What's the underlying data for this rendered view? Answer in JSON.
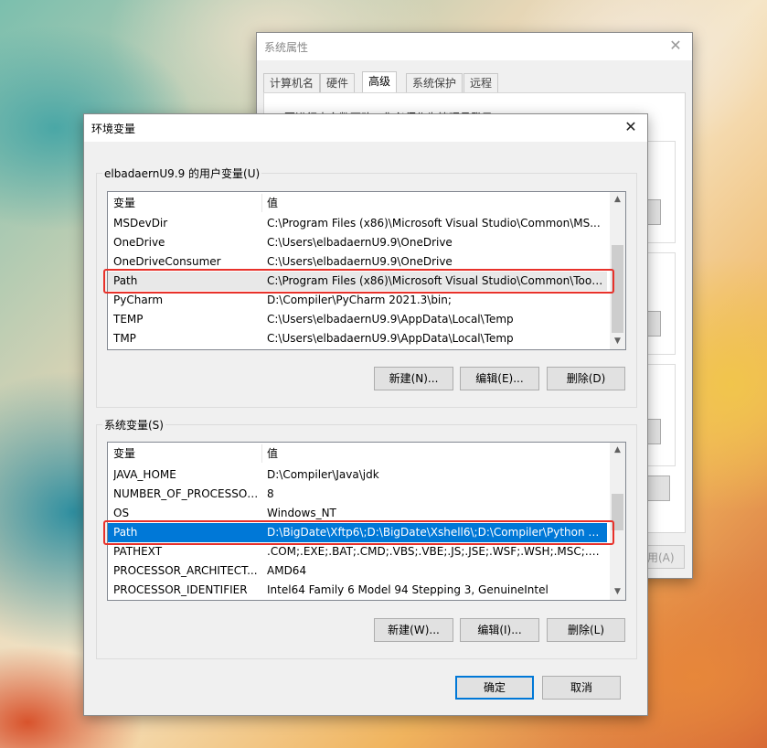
{
  "system_properties": {
    "title": "系统属性",
    "tabs": [
      {
        "label": "计算机名"
      },
      {
        "label": "硬件"
      },
      {
        "label": "高级"
      },
      {
        "label": "系统保护"
      },
      {
        "label": "远程"
      }
    ],
    "active_tab": "高级",
    "partial_text": "要进行大多数更改，你必须作为管理员登录。",
    "apply_label": "用(A)"
  },
  "env_dialog": {
    "title": "环境变量",
    "user_group_label": "elbadaernU9.9 的用户变量(U)",
    "system_group_label": "系统变量(S)",
    "columns": {
      "name": "变量",
      "value": "值"
    },
    "user_vars": [
      {
        "name": "MSDevDir",
        "value": "C:\\Program Files (x86)\\Microsoft Visual Studio\\Common\\MS..."
      },
      {
        "name": "OneDrive",
        "value": "C:\\Users\\elbadaernU9.9\\OneDrive"
      },
      {
        "name": "OneDriveConsumer",
        "value": "C:\\Users\\elbadaernU9.9\\OneDrive"
      },
      {
        "name": "Path",
        "value": "C:\\Program Files (x86)\\Microsoft Visual Studio\\Common\\Tool..."
      },
      {
        "name": "PyCharm",
        "value": "D:\\Compiler\\PyCharm 2021.3\\bin;"
      },
      {
        "name": "TEMP",
        "value": "C:\\Users\\elbadaernU9.9\\AppData\\Local\\Temp"
      },
      {
        "name": "TMP",
        "value": "C:\\Users\\elbadaernU9.9\\AppData\\Local\\Temp"
      }
    ],
    "system_vars": [
      {
        "name": "JAVA_HOME",
        "value": "D:\\Compiler\\Java\\jdk"
      },
      {
        "name": "NUMBER_OF_PROCESSORS",
        "value": "8"
      },
      {
        "name": "OS",
        "value": "Windows_NT"
      },
      {
        "name": "Path",
        "value": "D:\\BigDate\\Xftp6\\;D:\\BigDate\\Xshell6\\;D:\\Compiler\\Python 3\\..."
      },
      {
        "name": "PATHEXT",
        "value": ".COM;.EXE;.BAT;.CMD;.VBS;.VBE;.JS;.JSE;.WSF;.WSH;.MSC;.PY;.P..."
      },
      {
        "name": "PROCESSOR_ARCHITECT...",
        "value": "AMD64"
      },
      {
        "name": "PROCESSOR_IDENTIFIER",
        "value": "Intel64 Family 6 Model 94 Stepping 3, GenuineIntel"
      }
    ],
    "user_buttons": {
      "new": "新建(N)...",
      "edit": "编辑(E)...",
      "delete": "删除(D)"
    },
    "system_buttons": {
      "new": "新建(W)...",
      "edit": "编辑(I)...",
      "delete": "删除(L)"
    },
    "ok": "确定",
    "cancel": "取消"
  },
  "colors": {
    "highlight": "#e8312a",
    "selection": "#0078d7"
  },
  "icons": {
    "close": "close-icon",
    "scroll_up": "scroll-up-icon",
    "scroll_down": "scroll-down-icon"
  }
}
